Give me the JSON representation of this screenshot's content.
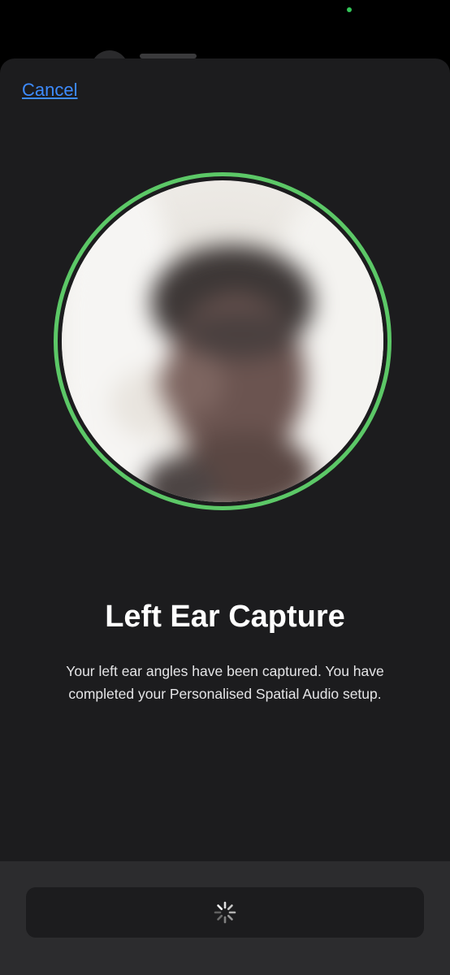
{
  "header": {
    "cancel_label": "Cancel"
  },
  "capture": {
    "status": "captured",
    "ring_color": "#5cc867"
  },
  "content": {
    "title": "Left Ear Capture",
    "description": "Your left ear angles have been captured. You have completed your Personalised Spatial Audio setup."
  },
  "footer": {
    "button_state": "loading",
    "spinner_icon": "activity-spinner-icon"
  },
  "colors": {
    "accent": "#3d8bff",
    "success": "#34c759",
    "sheet_background": "#1c1c1e"
  }
}
